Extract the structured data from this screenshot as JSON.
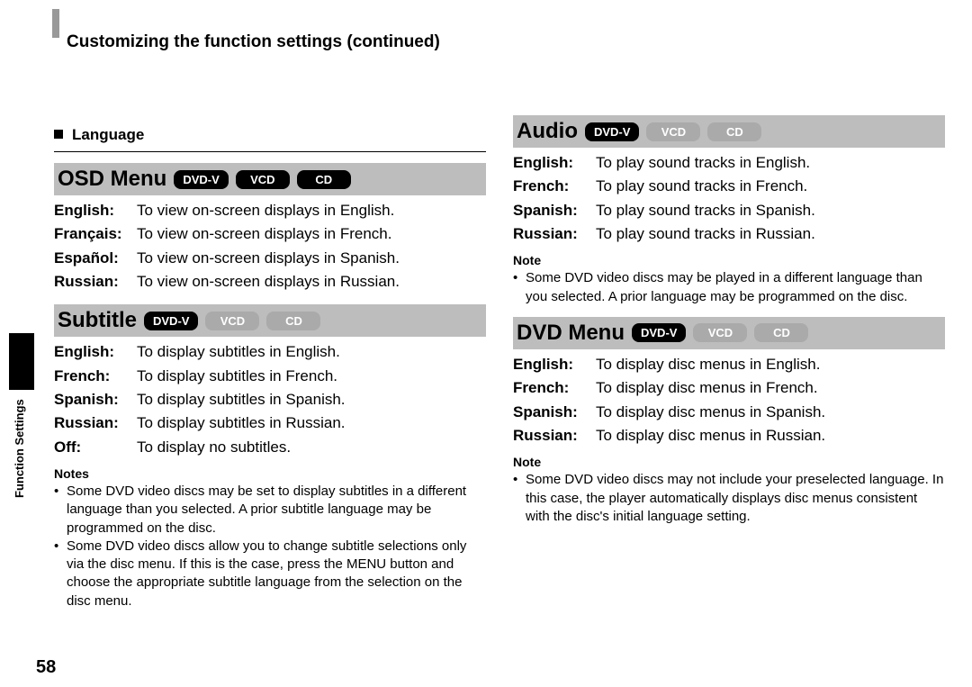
{
  "header": {
    "title": "Customizing the function settings (continued)"
  },
  "side": {
    "label": "Function Settings"
  },
  "page_number": "58",
  "labels": {
    "language": "Language",
    "notes": "Notes",
    "note": "Note"
  },
  "badges": {
    "dvdv": "DVD-V",
    "vcd": "VCD",
    "cd": "CD"
  },
  "osd_menu": {
    "title": "OSD Menu",
    "rows": [
      {
        "term": "English:",
        "desc": "To view on-screen displays in English."
      },
      {
        "term": "Français:",
        "desc": "To view on-screen displays in French."
      },
      {
        "term": "Español:",
        "desc": "To view on-screen displays in Spanish."
      },
      {
        "term": "Russian:",
        "desc": "To view on-screen displays in Russian."
      }
    ]
  },
  "subtitle": {
    "title": "Subtitle",
    "rows": [
      {
        "term": "English:",
        "desc": "To display subtitles in English."
      },
      {
        "term": "French:",
        "desc": "To display subtitles in French."
      },
      {
        "term": "Spanish:",
        "desc": "To display subtitles in Spanish."
      },
      {
        "term": "Russian:",
        "desc": "To display subtitles in Russian."
      },
      {
        "term": "Off:",
        "desc": "To display no subtitles."
      }
    ],
    "notes": [
      "Some DVD video discs may be set to display subtitles in a different language than you selected. A prior subtitle language may be programmed on the disc.",
      "Some DVD video discs allow you to change subtitle selections only via the disc menu. If this is the case, press the MENU button and choose the appropriate subtitle language from the selection on the disc menu."
    ]
  },
  "audio": {
    "title": "Audio",
    "rows": [
      {
        "term": "English:",
        "desc": "To play sound tracks in English."
      },
      {
        "term": "French:",
        "desc": "To play sound tracks in French."
      },
      {
        "term": "Spanish:",
        "desc": "To play sound tracks in Spanish."
      },
      {
        "term": "Russian:",
        "desc": "To play sound tracks in Russian."
      }
    ],
    "notes": [
      "Some DVD video discs may be played in a different language than you selected. A prior language may be programmed on the disc."
    ]
  },
  "dvd_menu": {
    "title": "DVD Menu",
    "rows": [
      {
        "term": "English:",
        "desc": "To display disc menus in English."
      },
      {
        "term": "French:",
        "desc": "To display disc menus in French."
      },
      {
        "term": "Spanish:",
        "desc": "To display disc menus in Spanish."
      },
      {
        "term": "Russian:",
        "desc": "To display disc menus in Russian."
      }
    ],
    "notes": [
      "Some DVD video discs may not include your preselected language. In this case, the player automatically displays disc menus consistent with the disc's initial language setting."
    ]
  }
}
